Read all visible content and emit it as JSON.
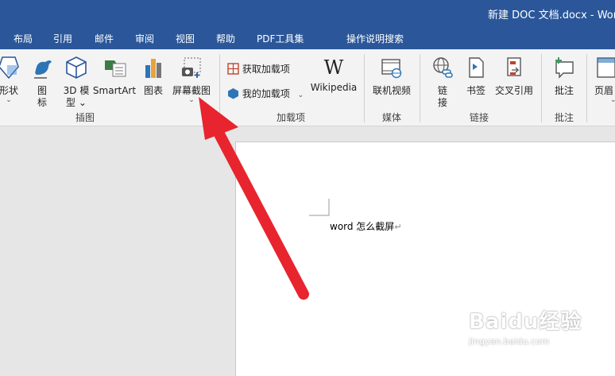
{
  "window": {
    "title": "新建 DOC 文档.docx  -  Wor"
  },
  "menu": [
    "布局",
    "引用",
    "邮件",
    "审阅",
    "视图",
    "帮助",
    "PDF工具集",
    "操作说明搜索"
  ],
  "ribbon": {
    "illustrations": {
      "shapes": "形状",
      "icons_line1": "图",
      "icons_line2": "标",
      "models_line1": "3D 模",
      "models_line2": "型",
      "smartart": "SmartArt",
      "chart": "图表",
      "screenshot": "屏幕截图",
      "group_label": "插图"
    },
    "addins": {
      "get_addins": "获取加载项",
      "my_addins": "我的加载项",
      "wikipedia": "Wikipedia",
      "group_label": "加载项"
    },
    "media": {
      "online_video": "联机视频",
      "group_label": "媒体"
    },
    "links": {
      "link_line1": "链",
      "link_line2": "接",
      "bookmark": "书签",
      "cross_ref": "交叉引用",
      "group_label": "链接"
    },
    "comments": {
      "comment": "批注",
      "group_label": "批注"
    },
    "header_footer": {
      "page_label": "页眉"
    }
  },
  "document": {
    "text": "word 怎么截屏"
  },
  "watermark": {
    "main": "Baidu经验",
    "url": "jingyan.baidu.com"
  },
  "colors": {
    "titlebar": "#2b579a",
    "ribbon": "#f3f3f3",
    "arrow": "#e8242f"
  }
}
